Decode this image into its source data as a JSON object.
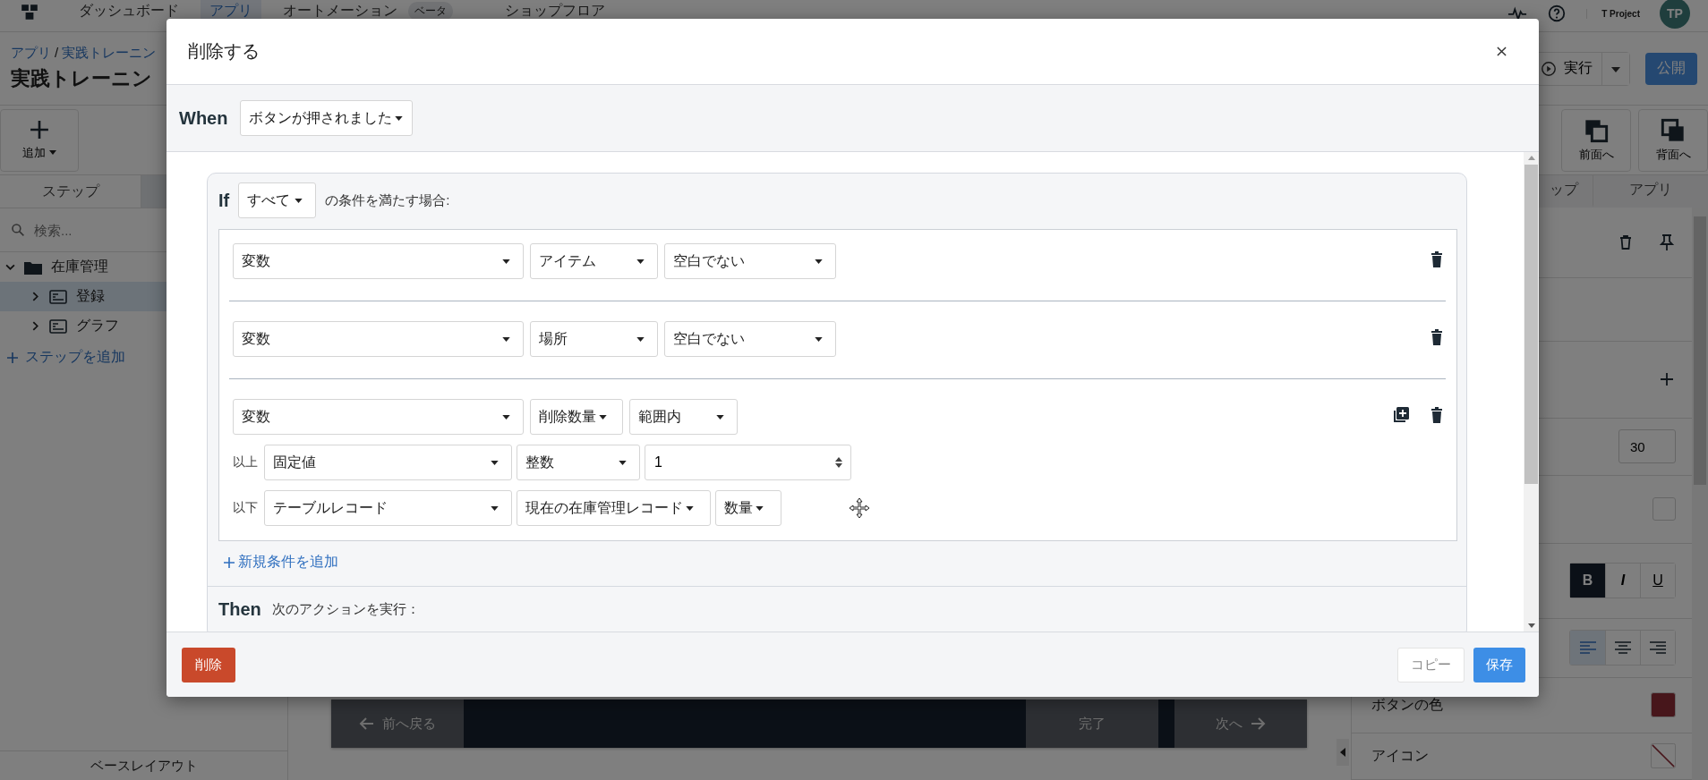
{
  "nav": {
    "items": [
      {
        "label": "ダッシュボード",
        "selected": false
      },
      {
        "label": "アプリ",
        "selected": true
      },
      {
        "label": "オートメーション",
        "selected": false,
        "badge": "ベータ"
      },
      {
        "label": "ショップフロア",
        "selected": false
      }
    ],
    "project": "T Project",
    "avatar": "TP"
  },
  "header": {
    "breadcrumb": [
      "アプリ",
      "実践トレーニン"
    ],
    "separator": "/",
    "title": "実践トレーニン",
    "run_button": "実行",
    "publish_button": "公開"
  },
  "toolbar": {
    "add_button": "追加",
    "right_buttons": [
      {
        "label": "前面へ",
        "kind": "front"
      },
      {
        "label": "背面へ",
        "kind": "back"
      }
    ]
  },
  "sidebar": {
    "tabs": [
      {
        "label": "ステップ",
        "selected": true
      }
    ],
    "search": {
      "placeholder": "検索..."
    },
    "tree": [
      {
        "label": "在庫管理",
        "kind": "folder",
        "expanded": true,
        "selected": false,
        "children": [
          {
            "label": "登録",
            "kind": "step",
            "expanded": false,
            "selected": true
          },
          {
            "label": "グラフ",
            "kind": "step",
            "expanded": false,
            "selected": false
          }
        ]
      }
    ],
    "add_step": "ステップを追加",
    "footer": "ベースレイアウト"
  },
  "canvas": {
    "nav_buttons": [
      {
        "label": "前へ戻る",
        "kind": "back"
      },
      {
        "label": "完了",
        "kind": "done"
      },
      {
        "label": "次へ",
        "kind": "next"
      }
    ]
  },
  "properties": {
    "tabs": [
      {
        "label": "ップ",
        "selected": false
      },
      {
        "label": "アプリ",
        "selected": false
      }
    ],
    "rows": [
      {
        "kind": "actions"
      },
      {
        "kind": "empty"
      },
      {
        "kind": "add"
      },
      {
        "kind": "number",
        "value": "30"
      },
      {
        "kind": "checkbox",
        "checked": false
      },
      {
        "kind": "font_style",
        "options": [
          {
            "label": "B",
            "kind": "bold",
            "selected": true
          },
          {
            "label": "I",
            "kind": "italic",
            "selected": false
          },
          {
            "label": "U",
            "kind": "underline",
            "selected": false
          }
        ]
      },
      {
        "kind": "align",
        "options": [
          {
            "kind": "left",
            "selected": true
          },
          {
            "kind": "center",
            "selected": false
          },
          {
            "kind": "right",
            "selected": false
          }
        ]
      },
      {
        "kind": "color",
        "label": "ボタンの色"
      },
      {
        "kind": "icon",
        "label": "アイコン"
      }
    ]
  },
  "dialog": {
    "title": "削除する",
    "when": {
      "label": "When",
      "trigger": "ボタンが押されました"
    },
    "if": {
      "label": "If",
      "match": "すべて",
      "suffix": "の条件を満たす場合:"
    },
    "conditions": [
      {
        "duplicable": false,
        "parts": [
          {
            "kind": "select",
            "value": "変数"
          },
          {
            "kind": "select",
            "value": "アイテム"
          },
          {
            "kind": "select",
            "value": "空白でない"
          }
        ]
      },
      {
        "duplicable": false,
        "parts": [
          {
            "kind": "select",
            "value": "変数"
          },
          {
            "kind": "select",
            "value": "場所"
          },
          {
            "kind": "select",
            "value": "空白でない"
          }
        ]
      },
      {
        "duplicable": true,
        "parts": [
          {
            "kind": "select",
            "value": "変数"
          },
          {
            "kind": "compact",
            "value": "削除数量"
          },
          {
            "kind": "select",
            "value": "範囲内"
          }
        ],
        "ranges": [
          {
            "label": "以上",
            "parts": [
              {
                "kind": "select",
                "value": "固定値"
              },
              {
                "kind": "select",
                "value": "整数"
              },
              {
                "kind": "number",
                "value": "1"
              }
            ]
          },
          {
            "label": "以下",
            "parts": [
              {
                "kind": "select",
                "value": "テーブルレコード"
              },
              {
                "kind": "compact",
                "value": "現在の在庫管理レコード"
              },
              {
                "kind": "compact",
                "value": "数量"
              }
            ]
          }
        ]
      }
    ],
    "add_condition": "新規条件を追加",
    "then": {
      "label": "Then",
      "text": "次のアクションを実行："
    },
    "delete_button": "削除",
    "copy_button": "コピー",
    "save_button": "保存"
  }
}
